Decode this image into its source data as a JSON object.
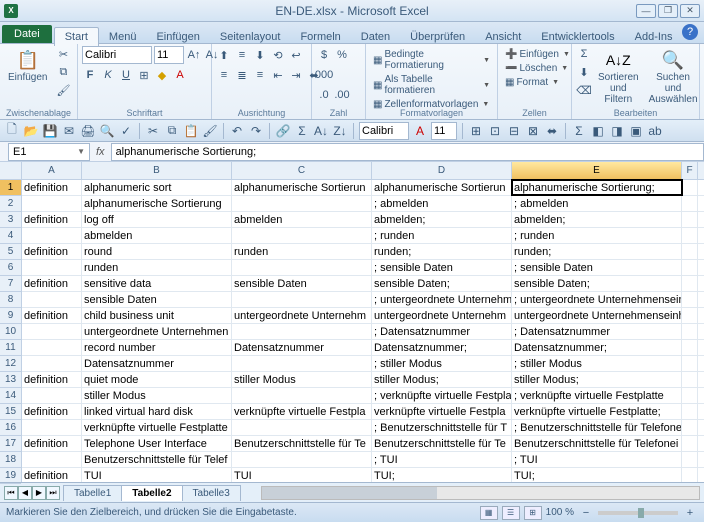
{
  "title": "EN-DE.xlsx - Microsoft Excel",
  "file_tab": "Datei",
  "tabs": [
    "Start",
    "Menü",
    "Einfügen",
    "Seitenlayout",
    "Formeln",
    "Daten",
    "Überprüfen",
    "Ansicht",
    "Entwicklertools",
    "Add-Ins"
  ],
  "active_tab": 0,
  "ribbon": {
    "clipboard": {
      "label": "Zwischenablage",
      "paste": "Einfügen"
    },
    "font": {
      "label": "Schriftart",
      "name": "Calibri",
      "size": "11"
    },
    "align": {
      "label": "Ausrichtung"
    },
    "number": {
      "label": "Zahl"
    },
    "styles": {
      "label": "Formatvorlagen",
      "cond": "Bedingte Formatierung",
      "table": "Als Tabelle formatieren",
      "cell": "Zellenformatvorlagen"
    },
    "cells": {
      "label": "Zellen",
      "insert": "Einfügen",
      "delete": "Löschen",
      "format": "Format"
    },
    "edit": {
      "label": "Bearbeiten",
      "sort": "Sortieren und Filtern",
      "find": "Suchen und Auswählen"
    }
  },
  "qat_font": {
    "name": "Calibri",
    "size": "11"
  },
  "namebox": "E1",
  "formula": "alphanumerische Sortierung;",
  "columns": [
    "A",
    "B",
    "C",
    "D",
    "E",
    "F"
  ],
  "rows": [
    "1",
    "2",
    "3",
    "4",
    "5",
    "6",
    "7",
    "8",
    "9",
    "10",
    "11",
    "12",
    "13",
    "14",
    "15",
    "16",
    "17",
    "18",
    "19"
  ],
  "active_cell": {
    "row": 0,
    "col": 4
  },
  "cells": [
    [
      "definition",
      "alphanumeric sort",
      "alphanumerische Sortierun",
      "alphanumerische Sortierun",
      "alphanumerische Sortierung;"
    ],
    [
      "",
      "alphanumerische Sortierung",
      "",
      "; abmelden",
      "; abmelden"
    ],
    [
      "definition",
      "log off",
      "abmelden",
      "abmelden;",
      "abmelden;"
    ],
    [
      "",
      "abmelden",
      "",
      "; runden",
      "; runden"
    ],
    [
      "definition",
      "round",
      "runden",
      "runden;",
      "runden;"
    ],
    [
      "",
      "runden",
      "",
      "; sensible Daten",
      "; sensible Daten"
    ],
    [
      "definition",
      "sensitive data",
      "sensible Daten",
      "sensible Daten;",
      "sensible Daten;"
    ],
    [
      "",
      "sensible Daten",
      "",
      "; untergeordnete Unternehm",
      "; untergeordnete Unternehmenseinh"
    ],
    [
      "definition",
      "child business unit",
      "untergeordnete Unternehm",
      "untergeordnete Unternehm",
      "untergeordnete Unternehmenseinh"
    ],
    [
      "",
      "untergeordnete Unternehmen",
      "",
      "; Datensatznummer",
      "; Datensatznummer"
    ],
    [
      "",
      "record number",
      "Datensatznummer",
      "Datensatznummer;",
      "Datensatznummer;"
    ],
    [
      "",
      "Datensatznummer",
      "",
      "; stiller Modus",
      "; stiller Modus"
    ],
    [
      "definition",
      "quiet mode",
      "stiller Modus",
      "stiller Modus;",
      "stiller Modus;"
    ],
    [
      "",
      "stiller Modus",
      "",
      "; verknüpfte virtuelle Festpla",
      "; verknüpfte virtuelle Festplatte"
    ],
    [
      "definition",
      "linked virtual hard disk",
      "verknüpfte virtuelle Festpla",
      "verknüpfte virtuelle Festpla",
      "verknüpfte virtuelle Festplatte;"
    ],
    [
      "",
      "verknüpfte virtuelle Festplatte",
      "",
      "; Benutzerschnittstelle für T",
      "; Benutzerschnittstelle für Telefone"
    ],
    [
      "definition",
      "Telephone User Interface",
      "Benutzerschnittstelle für Te",
      "Benutzerschnittstelle für Te",
      "Benutzerschnittstelle für Telefonei"
    ],
    [
      "",
      "Benutzerschnittstelle für Telef",
      "",
      "; TUI",
      "; TUI"
    ],
    [
      "definition",
      "TUI",
      "TUI",
      "TUI;",
      "TUI;"
    ]
  ],
  "sheets": [
    "Tabelle1",
    "Tabelle2",
    "Tabelle3"
  ],
  "active_sheet": 1,
  "status_msg": "Markieren Sie den Zielbereich, und drücken Sie die Eingabetaste.",
  "zoom": "100 %"
}
